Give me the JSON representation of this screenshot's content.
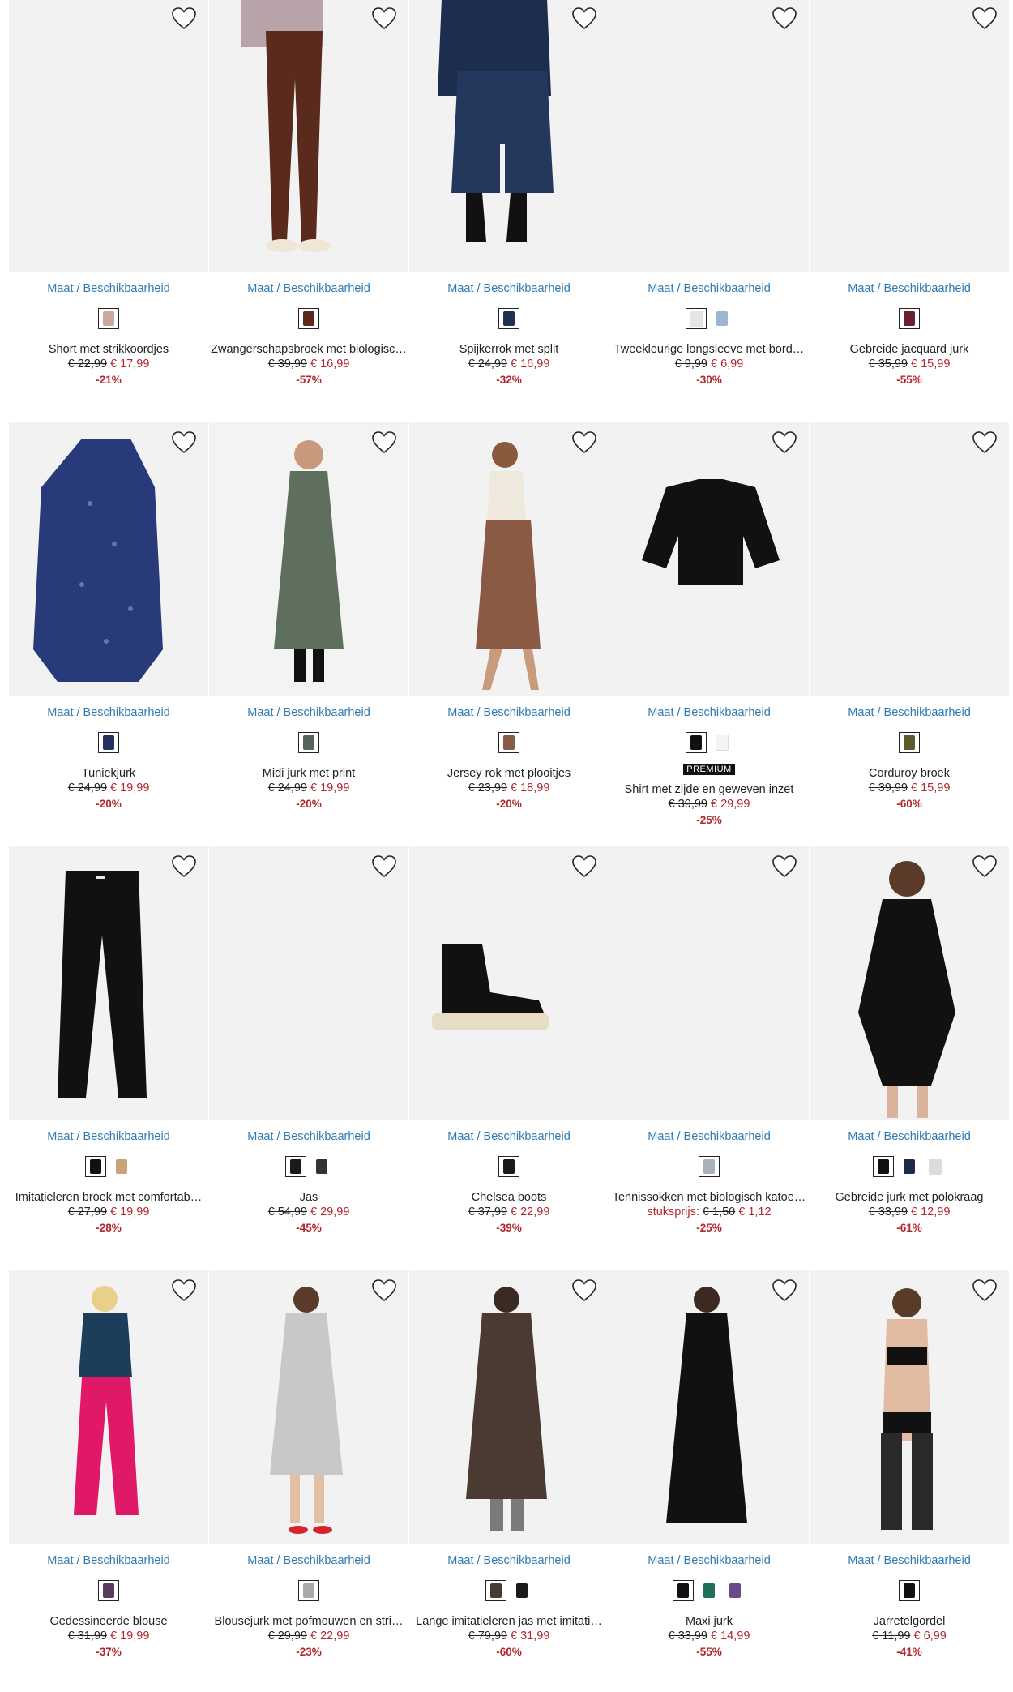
{
  "maat_label": "Maat / Beschikbaarheid",
  "products": [
    {
      "title": "Short met strikkoordjes",
      "old": "€ 22,99",
      "new": "€ 17,99",
      "disc": "-21%",
      "swatches": [
        "#c9a99a"
      ]
    },
    {
      "title": "Zwangerschapsbroek met biologisc…",
      "old": "€ 39,99",
      "new": "€ 16,99",
      "disc": "-57%",
      "swatches": [
        "#5a2a1c"
      ]
    },
    {
      "title": "Spijkerrok met split",
      "old": "€ 24,99",
      "new": "€ 16,99",
      "disc": "-32%",
      "swatches": [
        "#1f3150"
      ]
    },
    {
      "title": "Tweekleurige longsleeve met bord…",
      "old": "€ 9,99",
      "new": "€ 6,99",
      "disc": "-30%",
      "swatches": [
        "#e6e6e6",
        "#9bb6d0"
      ]
    },
    {
      "title": "Gebreide jacquard jurk",
      "old": "€ 35,99",
      "new": "€ 15,99",
      "disc": "-55%",
      "swatches": [
        "#6b2230"
      ]
    },
    {
      "title": "Tuniekjurk",
      "old": "€ 24,99",
      "new": "€ 19,99",
      "disc": "-20%",
      "swatches": [
        "#24305e"
      ]
    },
    {
      "title": "Midi jurk met print",
      "old": "€ 24,99",
      "new": "€ 19,99",
      "disc": "-20%",
      "swatches": [
        "#55655a"
      ]
    },
    {
      "title": "Jersey rok met plooitjes",
      "old": "€ 23,99",
      "new": "€ 18,99",
      "disc": "-20%",
      "swatches": [
        "#8a5a45"
      ]
    },
    {
      "title": "Shirt met zijde en geweven inzet",
      "old": "€ 39,99",
      "new": "€ 29,99",
      "disc": "-25%",
      "badge": "PREMIUM",
      "swatches": [
        "#111111",
        "#f4f4f4"
      ]
    },
    {
      "title": "Corduroy broek",
      "old": "€ 39,99",
      "new": "€ 15,99",
      "disc": "-60%",
      "swatches": [
        "#5b5b2c"
      ]
    },
    {
      "title": "Imitatieleren broek met comfortab…",
      "old": "€ 27,99",
      "new": "€ 19,99",
      "disc": "-28%",
      "swatches": [
        "#111111",
        "#c9a47a"
      ]
    },
    {
      "title": "Jas",
      "old": "€ 54,99",
      "new": "€ 29,99",
      "disc": "-45%",
      "swatches": [
        "#1a1a1a",
        "#333333"
      ]
    },
    {
      "title": "Chelsea boots",
      "old": "€ 37,99",
      "new": "€ 22,99",
      "disc": "-39%",
      "swatches": [
        "#1a1a1a"
      ]
    },
    {
      "title": "Tennissokken met biologisch katoe…",
      "unit": "stuksprijs:",
      "old": "€ 1,50",
      "new": "€ 1,12",
      "disc": "-25%",
      "swatches": [
        "#a9b0b8"
      ]
    },
    {
      "title": "Gebreide jurk met polokraag",
      "old": "€ 33,99",
      "new": "€ 12,99",
      "disc": "-61%",
      "swatches": [
        "#111111",
        "#1f2a4a",
        "#dcdcdc"
      ]
    },
    {
      "title": "Gedessineerde blouse",
      "old": "€ 31,99",
      "new": "€ 19,99",
      "disc": "-37%",
      "swatches": [
        "#5b3b5e"
      ]
    },
    {
      "title": "Blousejurk met pofmouwen en stri…",
      "old": "€ 29,99",
      "new": "€ 22,99",
      "disc": "-23%",
      "swatches": [
        "#a9a9a9"
      ]
    },
    {
      "title": "Lange imitatieleren jas met imitati…",
      "old": "€ 79,99",
      "new": "€ 31,99",
      "disc": "-60%",
      "swatches": [
        "#4a3a32",
        "#1a1a1a"
      ]
    },
    {
      "title": "Maxi jurk",
      "old": "€ 33,99",
      "new": "€ 14,99",
      "disc": "-55%",
      "swatches": [
        "#111111",
        "#1f6f5a",
        "#6b4a8a"
      ]
    },
    {
      "title": "Jarretelgordel",
      "old": "€ 11,99",
      "new": "€ 6,99",
      "disc": "-41%",
      "swatches": [
        "#111111"
      ]
    }
  ]
}
